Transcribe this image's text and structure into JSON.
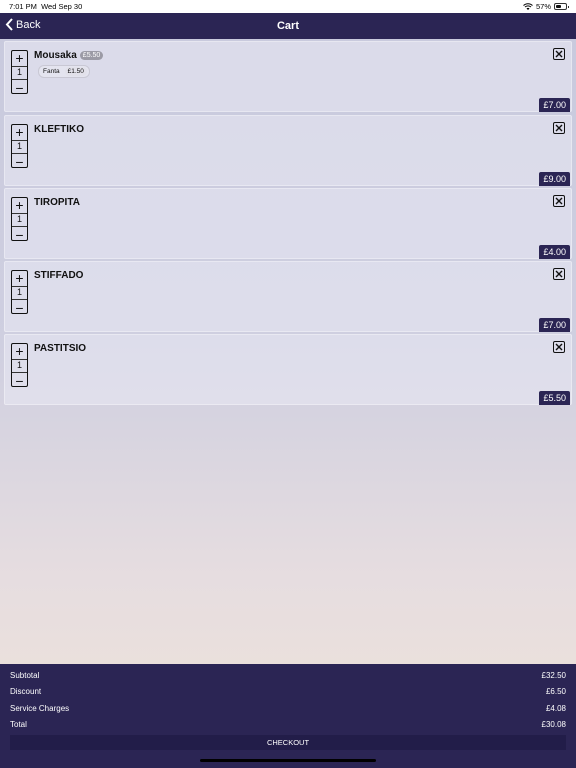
{
  "status_bar": {
    "time": "7:01 PM",
    "date": "Wed Sep 30",
    "battery": "57%",
    "battery_level": 0.57
  },
  "nav": {
    "back_label": "Back",
    "title": "Cart"
  },
  "items": [
    {
      "name": "Mousaka",
      "orig_price": "£5.50",
      "modifier": {
        "name": "Fanta",
        "price": "£1.50"
      },
      "qty": "1",
      "price": "£7.00"
    },
    {
      "name": "KLEFTIKO",
      "qty": "1",
      "price": "£9.00"
    },
    {
      "name": "TIROPITA",
      "qty": "1",
      "price": "£4.00"
    },
    {
      "name": "STIFFADO",
      "qty": "1",
      "price": "£7.00"
    },
    {
      "name": "PASTITSIO",
      "qty": "1",
      "price": "£5.50"
    }
  ],
  "totals": {
    "subtotal_label": "Subtotal",
    "subtotal": "£32.50",
    "discount_label": "Discount",
    "discount": "£6.50",
    "service_label": "Service Charges",
    "service": "£4.08",
    "total_label": "Total",
    "total": "£30.08"
  },
  "checkout_label": "CHECKOUT",
  "colors": {
    "nav": "#2b2554",
    "price_badge": "#2b2554",
    "checkout": "#221d49"
  },
  "icons": {
    "back": "chevron-left-icon",
    "increment": "plus-icon",
    "decrement": "minus-icon",
    "remove": "close-box-icon"
  }
}
